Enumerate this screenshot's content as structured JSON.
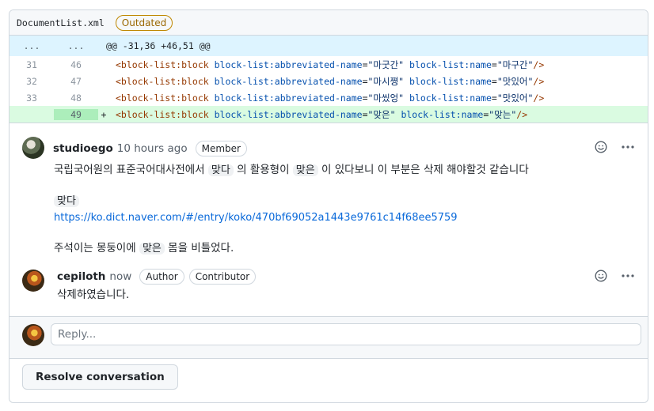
{
  "file": {
    "name": "DocumentList.xml",
    "status_badge": "Outdated"
  },
  "diff": {
    "hunk": {
      "old_ln": "...",
      "new_ln": "...",
      "header": "@@ -31,36 +46,51 @@"
    },
    "lines": [
      {
        "old": "31",
        "new": "46",
        "sign": "",
        "tag": "<block-list:block ",
        "a1": "block-list:abbreviated-name",
        "v1": "\"마굿간\"",
        "a2": "block-list:name",
        "v2": "\"마구간\"",
        "end": "/>"
      },
      {
        "old": "32",
        "new": "47",
        "sign": "",
        "tag": "<block-list:block ",
        "a1": "block-list:abbreviated-name",
        "v1": "\"마시쪙\"",
        "a2": "block-list:name",
        "v2": "\"맛있어\"",
        "end": "/>"
      },
      {
        "old": "33",
        "new": "48",
        "sign": "",
        "tag": "<block-list:block ",
        "a1": "block-list:abbreviated-name",
        "v1": "\"마씼엉\"",
        "a2": "block-list:name",
        "v2": "\"맛있어\"",
        "end": "/>"
      },
      {
        "old": "",
        "new": "49",
        "sign": "+",
        "tag": "<block-list:block ",
        "a1": "block-list:abbreviated-name",
        "v1": "\"맞은\"",
        "a2": "block-list:name",
        "v2": "\"맞는\"",
        "end": "/>"
      }
    ]
  },
  "comments": [
    {
      "author": "studioego",
      "time": "10 hours ago",
      "badges": [
        "Member"
      ],
      "p1_before": "국립국어원의 표준국어대사전에서 ",
      "p1_code1": "맞다",
      "p1_mid": " 의 활용형이 ",
      "p1_code2": "맞은",
      "p1_after": " 이 있다보니 이 부분은 삭제 해야할것 같습니다",
      "p2_code": "맞다",
      "p2_link": "https://ko.dict.naver.com/#/entry/koko/470bf69052a1443e9761c14f68ee5759",
      "p3_before": "주석이는 몽둥이에 ",
      "p3_code": "맞은",
      "p3_after": " 몸을 비틀었다."
    },
    {
      "author": "cepiloth",
      "time": "now",
      "badges": [
        "Author",
        "Contributor"
      ],
      "text": "삭제하였습니다."
    }
  ],
  "reply": {
    "placeholder": "Reply..."
  },
  "resolve_label": "Resolve conversation",
  "icons": {
    "reaction": "smiley-icon",
    "more": "kebab-horizontal-icon"
  }
}
